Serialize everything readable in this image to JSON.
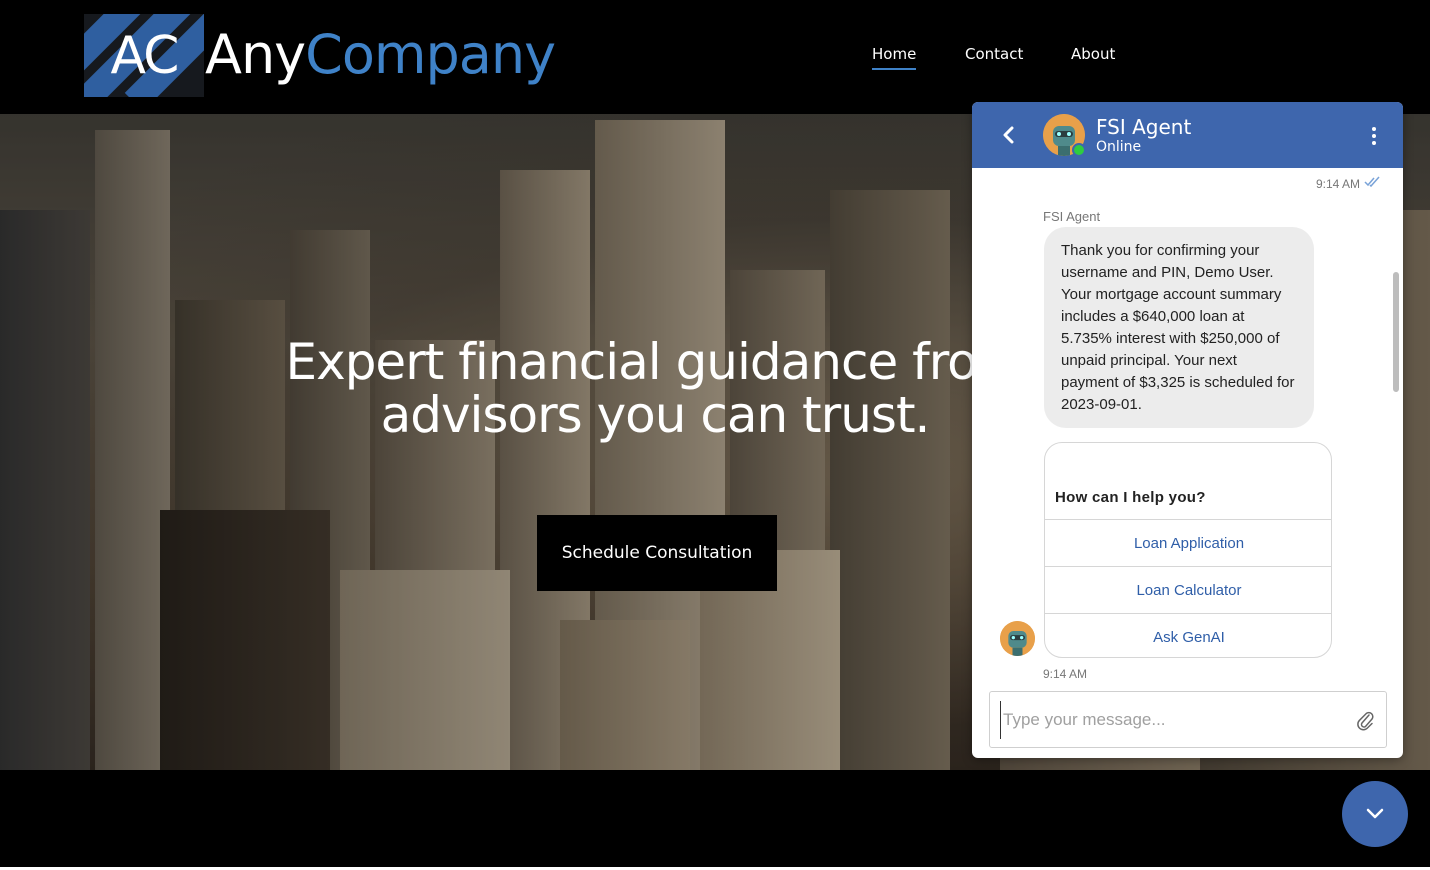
{
  "header": {
    "logo_monogram": "AC",
    "logo_word_any": "Any",
    "logo_word_company": "Company",
    "nav": [
      "Home",
      "Contact",
      "About"
    ],
    "active_nav": "Home"
  },
  "hero": {
    "title_line1": "Expert financial guidance from",
    "title_line2": "advisors you can trust.",
    "cta_label": "Schedule Consultation"
  },
  "chat": {
    "agent_name": "FSI Agent",
    "agent_status": "Online",
    "top_timestamp": "9:14 AM",
    "sender_label": "FSI Agent",
    "message": "Thank you for confirming your username and PIN, Demo User. Your mortgage account summary includes a $640,000 loan at 5.735% interest with $250,000 of unpaid principal. Your next payment of $3,325 is scheduled for 2023-09-01.",
    "card": {
      "title": "How can I help you?",
      "options": [
        "Loan Application",
        "Loan Calculator",
        "Ask GenAI"
      ]
    },
    "bottom_timestamp": "9:14 AM",
    "input_placeholder": "Type your message..."
  },
  "colors": {
    "brand_blue": "#3e66ad",
    "logo_blue": "#3f82c8",
    "online_green": "#2ecc40",
    "link_blue": "#2f5ea8"
  },
  "icons": [
    "back-arrow-icon",
    "kebab-menu-icon",
    "double-check-icon",
    "paperclip-icon",
    "chevron-down-icon",
    "agent-avatar-icon",
    "online-dot-icon"
  ]
}
